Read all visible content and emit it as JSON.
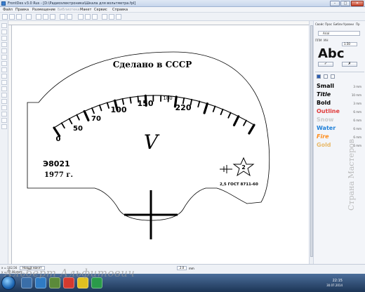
{
  "window": {
    "title": "FrontDes v3.0 Rus - [D:\\Радиоэлектроника\\Шкала для вольтметра.fpl]"
  },
  "menu": {
    "items": [
      "Файл",
      "Правка",
      "Размещение",
      "Библиотека",
      "Макет",
      "Сервис",
      "Справка"
    ]
  },
  "right_panel": {
    "tabs": [
      "Свойс",
      "Прос",
      "Библи",
      "Уровни",
      "Пр"
    ],
    "font_name": "Arial",
    "ppm_label": "ППМ",
    "size_label": "МН",
    "size_value": "1.50",
    "preview_text": "Abc",
    "ok_label": "✓",
    "cancel_label": "✗",
    "styles": [
      {
        "name": "Small",
        "size": "3 mm",
        "color": "#000000",
        "italic": false
      },
      {
        "name": "Title",
        "size": "10 mm",
        "color": "#000000",
        "italic": true
      },
      {
        "name": "Bold",
        "size": "3 mm",
        "color": "#000000",
        "italic": false
      },
      {
        "name": "Outline",
        "size": "6 mm",
        "color": "#e03b3b",
        "italic": false
      },
      {
        "name": "Snow",
        "size": "6 mm",
        "color": "#c8c8c8",
        "italic": false
      },
      {
        "name": "Water",
        "size": "6 mm",
        "color": "#1e7fd8",
        "italic": false
      },
      {
        "name": "Fire",
        "size": "6 mm",
        "color": "#ff8c1a",
        "italic": true
      },
      {
        "name": "Gold",
        "size": "6 mm",
        "color": "#e8b96a",
        "italic": false
      }
    ]
  },
  "design": {
    "top_label": "Сделано в СССР",
    "scale_labels": [
      "0",
      "50",
      "70",
      "100",
      "150",
      "180",
      "220"
    ],
    "unit_symbol": "V",
    "model": "Э8021",
    "year": "1977 г.",
    "class_value": "2",
    "standard": "2,5  ГОСТ 8711-60"
  },
  "status": {
    "coord_x": "x = 102,56",
    "coord_y": "y = 77,08 mm",
    "tab": "Новый макет",
    "zoom_value": "2.0",
    "unit": "mm"
  },
  "taskbar": {
    "time": "22:15",
    "date": "30.07.2014"
  },
  "watermark": {
    "author": "Альберт Альфитович",
    "site": "Страна Мастеров"
  }
}
